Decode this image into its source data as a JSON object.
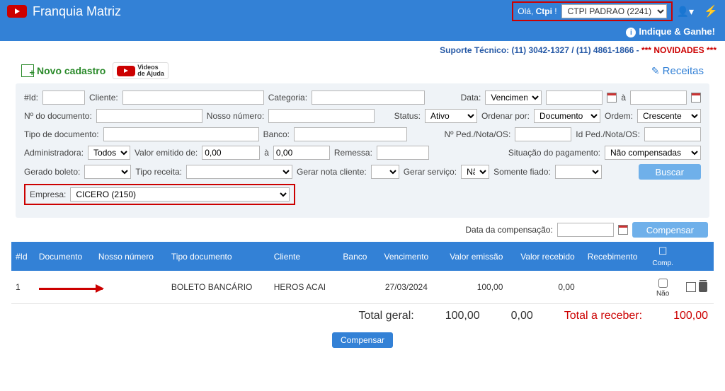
{
  "header": {
    "title": "Franquia Matriz",
    "greeting_prefix": "Olá, ",
    "greeting_user": "Ctpi",
    "greeting_suffix": " !",
    "user_dropdown": "CTPI PADRAO (2241)",
    "indique_label": "Indique & Ganhe!"
  },
  "support": {
    "text": "Suporte Técnico: (11) 3042-1327 / (11) 4861-1866 - ",
    "novidades": "*** NOVIDADES ***"
  },
  "toolbar": {
    "novo_cadastro": "Novo cadastro",
    "videos_ajuda_line1": "Videos",
    "videos_ajuda_line2": "de Ajuda",
    "receitas": "Receitas"
  },
  "filters": {
    "id_label": "#Id:",
    "cliente_label": "Cliente:",
    "categoria_label": "Categoria:",
    "data_label": "Data:",
    "data_select": "Vencimento:",
    "a_label": "à",
    "ndoc_label": "Nº do documento:",
    "nosso_numero_label": "Nosso número:",
    "status_label": "Status:",
    "status_value": "Ativo",
    "ordenar_por_label": "Ordenar por:",
    "ordenar_por_value": "Documento",
    "ordem_label": "Ordem:",
    "ordem_value": "Crescente",
    "tipo_doc_label": "Tipo de documento:",
    "banco_label": "Banco:",
    "nped_label": "Nº Ped./Nota/OS:",
    "idped_label": "Id Ped./Nota/OS:",
    "admin_label": "Administradora:",
    "admin_value": "Todos",
    "valor_emitido_label": "Valor emitido de:",
    "valor_de": "0,00",
    "valor_a_label": "à",
    "valor_ate": "0,00",
    "remessa_label": "Remessa:",
    "situacao_label": "Situação do pagamento:",
    "situacao_value": "Não compensadas",
    "gerado_boleto_label": "Gerado boleto:",
    "tipo_receita_label": "Tipo receita:",
    "gerar_nota_label": "Gerar nota cliente:",
    "gerar_servico_label": "Gerar serviço:",
    "gerar_servico_value": "Não",
    "somente_fiado_label": "Somente fiado:",
    "buscar_label": "Buscar",
    "empresa_label": "Empresa:",
    "empresa_value": "CICERO (2150)"
  },
  "compensation": {
    "data_comp_label": "Data da compensação:",
    "compensar_label": "Compensar"
  },
  "table": {
    "headers": {
      "id": "#Id",
      "documento": "Documento",
      "nosso_numero": "Nosso número",
      "tipo_documento": "Tipo documento",
      "cliente": "Cliente",
      "banco": "Banco",
      "vencimento": "Vencimento",
      "valor_emissao": "Valor emissão",
      "valor_recebido": "Valor recebido",
      "recebimento": "Recebimento",
      "comp": "Comp."
    },
    "rows": [
      {
        "id": "1",
        "documento": "",
        "nosso_numero": "",
        "tipo_documento": "BOLETO BANCÁRIO",
        "cliente": "HEROS ACAI",
        "banco": "",
        "vencimento": "27/03/2024",
        "valor_emissao": "100,00",
        "valor_recebido": "0,00",
        "recebimento": "",
        "comp": "Não"
      }
    ]
  },
  "totals": {
    "total_geral_label": "Total geral:",
    "total_geral_emissao": "100,00",
    "total_geral_recebido": "0,00",
    "total_receber_label": "Total a receber:",
    "total_receber_value": "100,00",
    "compensar_footer": "Compensar"
  }
}
